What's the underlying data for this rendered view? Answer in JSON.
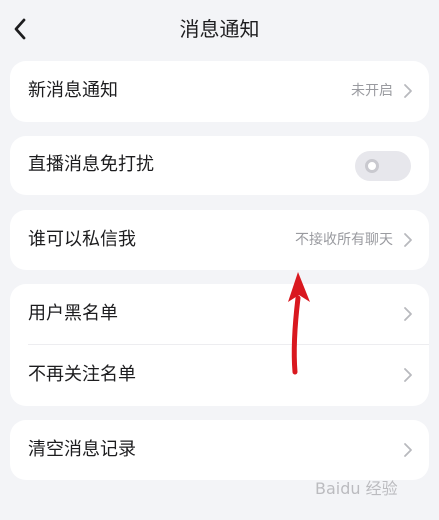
{
  "header": {
    "title": "消息通知",
    "back_icon": "chevron-left-icon"
  },
  "settings": {
    "new_message_notice": {
      "label": "新消息通知",
      "value": "未开启"
    },
    "live_dnd": {
      "label": "直播消息免打扰",
      "enabled": false
    },
    "who_can_message": {
      "label": "谁可以私信我",
      "value": "不接收所有聊天"
    },
    "blacklist": {
      "label": "用户黑名单"
    },
    "unfollow_list": {
      "label": "不再关注名单"
    },
    "clear_history": {
      "label": "清空消息记录"
    }
  },
  "annotation": {
    "type": "red-arrow-icon",
    "color": "#d9181f"
  },
  "watermark": {
    "text": "Baidu 经验"
  },
  "colors": {
    "background": "#f3f4f7",
    "card": "#ffffff",
    "secondary_text": "#9a9ba0",
    "toggle_off": "#e7e7ec"
  }
}
